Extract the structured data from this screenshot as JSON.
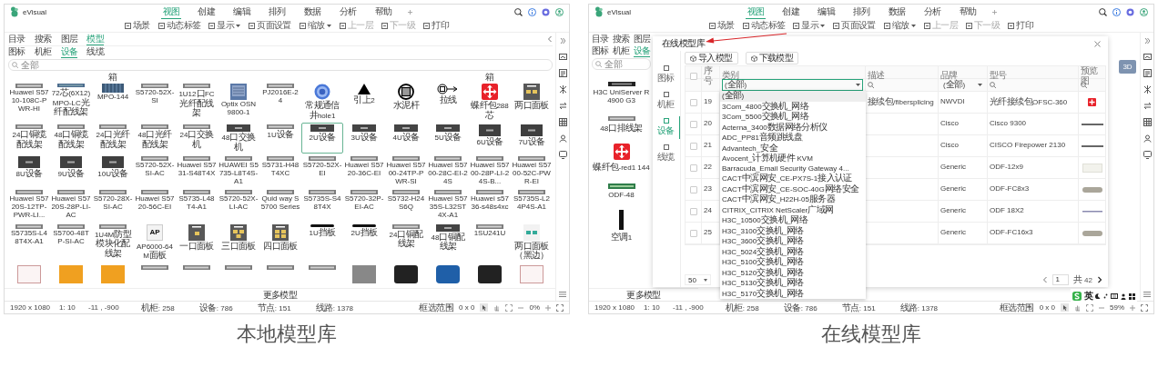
{
  "panels": [
    {
      "app_name": "eVisual",
      "menu_tabs": [
        {
          "label": "视图",
          "selected": true
        },
        {
          "label": "创建",
          "selected": false
        },
        {
          "label": "编辑",
          "selected": false
        },
        {
          "label": "排列",
          "selected": false
        },
        {
          "label": "数据",
          "selected": false
        },
        {
          "label": "分析",
          "selected": false
        },
        {
          "label": "帮助",
          "selected": false
        }
      ],
      "toolbar": [
        {
          "label": "场景",
          "dropdown": false,
          "disabled": false
        },
        {
          "label": "动态标签",
          "dropdown": false,
          "disabled": false
        },
        {
          "label": "显示",
          "dropdown": true,
          "disabled": false
        },
        {
          "label": "页面设置",
          "dropdown": false,
          "disabled": false
        },
        {
          "label": "缩放",
          "dropdown": true,
          "disabled": false
        },
        {
          "label": "上一层",
          "dropdown": false,
          "disabled": true
        },
        {
          "label": "下一级",
          "dropdown": false,
          "disabled": true
        },
        {
          "label": "打印",
          "dropdown": false,
          "disabled": false
        }
      ],
      "side_tabs": [
        {
          "label": "目录",
          "selected": false
        },
        {
          "label": "搜索",
          "selected": false
        },
        {
          "label": "图层",
          "selected": false
        },
        {
          "label": "模型",
          "selected": true
        }
      ],
      "sub_tabs": [
        {
          "label": "图标",
          "selected": false
        },
        {
          "label": "机柜",
          "selected": false
        },
        {
          "label": "设备",
          "selected": true
        },
        {
          "label": "线缆",
          "selected": false
        }
      ],
      "search": {
        "placeholder": "全部"
      },
      "model_grid": {
        "headings": [
          "箱",
          "箱"
        ],
        "items": [
          {
            "label": "Huawei S5710-108C-PWR-HI",
            "kind": "strip",
            "selected": false
          },
          {
            "label": "72芯(6X12)MPO-LC光纤配线架",
            "kind": "blue-strip",
            "selected": false
          },
          {
            "label": "MPO-144",
            "kind": "module",
            "selected": false
          },
          {
            "label": "S5720-52X-SI",
            "kind": "strip",
            "selected": false
          },
          {
            "label": "1U12口FC光纤配线架",
            "kind": "strip",
            "selected": false
          },
          {
            "label": "Optix OSN 9800-1",
            "kind": "chassis",
            "selected": false
          },
          {
            "label": "PJ2016E-24",
            "kind": "strip",
            "selected": false
          },
          {
            "label": "常规通信井hole1",
            "kind": "well",
            "selected": false
          },
          {
            "label": "引上2",
            "kind": "triangle",
            "selected": false
          },
          {
            "label": "水泥杆",
            "kind": "pole",
            "selected": false
          },
          {
            "label": "拉线",
            "kind": "guy",
            "selected": false
          },
          {
            "label": "蝶纤包288芯",
            "kind": "redbox",
            "selected": false
          },
          {
            "label": "两口面板",
            "kind": "panel2",
            "selected": false
          },
          {
            "label": "24口铜缆配线架",
            "kind": "strip",
            "selected": false
          },
          {
            "label": "48口铜缆配线架",
            "kind": "strip",
            "selected": false
          },
          {
            "label": "24口光纤配线架",
            "kind": "strip",
            "selected": false
          },
          {
            "label": "48口光纤配线架",
            "kind": "strip",
            "selected": false
          },
          {
            "label": "24口交换机",
            "kind": "strip",
            "selected": false
          },
          {
            "label": "48口交换机",
            "kind": "device",
            "selected": false
          },
          {
            "label": "1U设备",
            "kind": "strip",
            "selected": false
          },
          {
            "label": "2U设备",
            "kind": "device",
            "selected": true
          },
          {
            "label": "3U设备",
            "kind": "device",
            "selected": false
          },
          {
            "label": "4U设备",
            "kind": "device",
            "selected": false
          },
          {
            "label": "5U设备",
            "kind": "device",
            "selected": false
          },
          {
            "label": "6U设备",
            "kind": "block",
            "selected": false
          },
          {
            "label": "7U设备",
            "kind": "block",
            "selected": false
          },
          {
            "label": "8U设备",
            "kind": "block",
            "selected": false
          },
          {
            "label": "9U设备",
            "kind": "block",
            "selected": false
          },
          {
            "label": "10U设备",
            "kind": "block",
            "selected": false
          },
          {
            "label": "S5720-52X-SI-AC",
            "kind": "strip",
            "selected": false
          },
          {
            "label": "Huawei S5731-S48T4X",
            "kind": "strip",
            "selected": false
          },
          {
            "label": "HUAWEI S5735-L8T4S-A1",
            "kind": "strip",
            "selected": false
          },
          {
            "label": "S5731-H48T4XC",
            "kind": "strip",
            "selected": false
          },
          {
            "label": "S5720-52X-EI",
            "kind": "strip",
            "selected": false
          },
          {
            "label": "Huawei S5720-36C-EI",
            "kind": "strip",
            "selected": false
          },
          {
            "label": "Huawei S5700-24TP-PWR-SI",
            "kind": "strip",
            "selected": false
          },
          {
            "label": "Huawei S5700-28C-EI-24S",
            "kind": "strip",
            "selected": false
          },
          {
            "label": "Huawei S5700-28P-LI-24S-B...",
            "kind": "strip",
            "selected": false
          },
          {
            "label": "Huawei S5700-52C-PWR-EI",
            "kind": "strip",
            "selected": false
          },
          {
            "label": "Huawei S5720S-12TP-PWR-LI...",
            "kind": "strip",
            "selected": false
          },
          {
            "label": "Huawei S5720S-28P-LI-AC",
            "kind": "strip",
            "selected": false
          },
          {
            "label": "S5720-28X-SI-AC",
            "kind": "strip",
            "selected": false
          },
          {
            "label": "Huawei S5720-56C-EI",
            "kind": "strip",
            "selected": false
          },
          {
            "label": "S5735-L48T4-A1",
            "kind": "strip",
            "selected": false
          },
          {
            "label": "S5720-52X-LI-AC",
            "kind": "strip",
            "selected": false
          },
          {
            "label": "Quid way S5700 Series",
            "kind": "strip",
            "selected": false
          },
          {
            "label": "S5735S-S48T4X",
            "kind": "strip",
            "selected": false
          },
          {
            "label": "S5720-32P-EI-AC",
            "kind": "strip",
            "selected": false
          },
          {
            "label": "S5732-H24S6Q",
            "kind": "strip",
            "selected": false
          },
          {
            "label": "Huawei S5735S-L32ST4X-A1",
            "kind": "strip",
            "selected": false
          },
          {
            "label": "Huawei s5736-s48s4xc",
            "kind": "strip",
            "selected": false
          },
          {
            "label": "S5735S-L24P4S-A1",
            "kind": "strip",
            "selected": false
          },
          {
            "label": "S5735S-L48T4X-A1",
            "kind": "strip",
            "selected": false
          },
          {
            "label": "S5700-48TP-SI-AC",
            "kind": "strip",
            "selected": false
          },
          {
            "label": "1U4M防型模块化配线架",
            "kind": "strip",
            "selected": false
          },
          {
            "label": "AP6000-64M面板",
            "kind": "ap",
            "badge": "AP",
            "selected": false
          },
          {
            "label": "一口面板",
            "kind": "panel1",
            "selected": false
          },
          {
            "label": "三口面板",
            "kind": "panel3",
            "selected": false
          },
          {
            "label": "四口面板",
            "kind": "panel4",
            "selected": false
          },
          {
            "label": "1U挡板",
            "kind": "plate",
            "selected": false
          },
          {
            "label": "2U挡板",
            "kind": "plate",
            "selected": false
          },
          {
            "label": "24口铜配线架",
            "kind": "strip",
            "selected": false
          },
          {
            "label": "48口铜配线架",
            "kind": "device",
            "selected": false
          },
          {
            "label": "1SU241U",
            "kind": "strip",
            "selected": false
          },
          {
            "label": "两口面板（黑边）",
            "kind": "whitepanel",
            "selected": false
          },
          {
            "kind": "stub-light",
            "selected": false
          },
          {
            "kind": "stub-orange",
            "selected": false
          },
          {
            "kind": "stub-orange",
            "selected": false
          },
          {
            "kind": "strip",
            "selected": false
          },
          {
            "kind": "strip",
            "selected": false
          },
          {
            "kind": "strip",
            "selected": false
          },
          {
            "kind": "strip",
            "selected": false
          },
          {
            "kind": "strip",
            "selected": false
          },
          {
            "kind": "stub-grey",
            "selected": false
          },
          {
            "kind": "stub-dark",
            "selected": false
          },
          {
            "kind": "stub-blue",
            "selected": false
          },
          {
            "kind": "stub-dark",
            "selected": false
          },
          {
            "kind": "stub-light",
            "selected": false
          }
        ]
      },
      "more_button": "更多模型",
      "status_bar": {
        "resolution": "1920 x 1080",
        "scale": "1: 10",
        "position": "-11 , -900",
        "counts": [
          "机柜: 258",
          "设备: 786",
          "节点: 151",
          "线路: 1378"
        ],
        "selection_label": "框选范围",
        "selection": "0 x 0",
        "zoom": "0%"
      },
      "caption": "本地模型库"
    },
    {
      "app_name": "eVisual",
      "menu_tabs": [
        {
          "label": "视图",
          "selected": true
        },
        {
          "label": "创建",
          "selected": false
        },
        {
          "label": "编辑",
          "selected": false
        },
        {
          "label": "排列",
          "selected": false
        },
        {
          "label": "数据",
          "selected": false
        },
        {
          "label": "分析",
          "selected": false
        },
        {
          "label": "帮助",
          "selected": false
        }
      ],
      "toolbar": [
        {
          "label": "场景",
          "dropdown": false,
          "disabled": false
        },
        {
          "label": "动态标签",
          "dropdown": false,
          "disabled": false
        },
        {
          "label": "显示",
          "dropdown": true,
          "disabled": false
        },
        {
          "label": "页面设置",
          "dropdown": false,
          "disabled": false
        },
        {
          "label": "缩放",
          "dropdown": true,
          "disabled": false
        },
        {
          "label": "上一层",
          "dropdown": false,
          "disabled": true
        },
        {
          "label": "下一级",
          "dropdown": false,
          "disabled": true
        },
        {
          "label": "打印",
          "dropdown": false,
          "disabled": false
        }
      ],
      "side_tabs": [
        {
          "label": "目录",
          "selected": false
        },
        {
          "label": "搜索",
          "selected": false
        },
        {
          "label": "图层",
          "selected": false
        }
      ],
      "sub_tabs": [
        {
          "label": "图标",
          "selected": false
        },
        {
          "label": "机柜",
          "selected": false
        },
        {
          "label": "设备",
          "selected": true
        }
      ],
      "search": {
        "placeholder": "全部"
      },
      "model_list": [
        {
          "label": "H3C UniServer R4900 G3",
          "kind": "server"
        },
        {
          "label": "48口排线架",
          "kind": "strip"
        },
        {
          "label": "蝶纤包-red1 144",
          "kind": "redbox"
        },
        {
          "label": "ODF-48",
          "kind": "odf"
        },
        {
          "label": "空调1",
          "kind": "tower"
        }
      ],
      "canvas_button": "3D",
      "dialog": {
        "title": "在线模型库",
        "vtabs": [
          {
            "label": "图标",
            "selected": false
          },
          {
            "label": "机柜",
            "selected": false
          },
          {
            "label": "设备",
            "selected": true
          },
          {
            "label": "线缆",
            "selected": false
          }
        ],
        "actions": [
          "导入模型",
          "下载模型"
        ],
        "columns": [
          "序号",
          "类别",
          "描述",
          "品牌",
          "型号",
          "预览图"
        ],
        "all_checked": false,
        "category_filter": "(全部)",
        "brand_filter": "(全部)",
        "dropdown": [
          {
            "label": "(全部)",
            "selected": true
          },
          {
            "label": "3Com_4800交换机_网络",
            "selected": false
          },
          {
            "label": "3Com_5500交换机_网络",
            "selected": false
          },
          {
            "label": "Acterna_3400数据网络分析仪",
            "selected": false
          },
          {
            "label": "ADC_PP81音频跳线盘",
            "selected": false
          },
          {
            "label": "Advantech_安全",
            "selected": false
          },
          {
            "label": "Avocent_计算机硬件 KVM",
            "selected": false
          },
          {
            "label": "Barracuda_Email Security Gateway 4...",
            "selected": false
          },
          {
            "label": "CACT中滨网安_CE-PX7S-1接入认证",
            "selected": false
          },
          {
            "label": "CACT中滨网安_CE-SOC-40G网络安全",
            "selected": false
          },
          {
            "label": "CACT中滨网安_H22H-05服务器",
            "selected": false
          },
          {
            "label": "CITRIX_CITRIX NetScaler广域网",
            "selected": false
          },
          {
            "label": "H3C_10500交换机_网络",
            "selected": false
          },
          {
            "label": "H3C_3100交换机_网络",
            "selected": false
          },
          {
            "label": "H3C_3600交换机_网络",
            "selected": false
          },
          {
            "label": "H3C_5024交换机_网络",
            "selected": false
          },
          {
            "label": "H3C_5100交换机_网络",
            "selected": false
          },
          {
            "label": "H3C_5120交换机_网络",
            "selected": false
          },
          {
            "label": "H3C_5130交换机_网络",
            "selected": false
          },
          {
            "label": "H3C_5170交换机_网络",
            "selected": false
          }
        ],
        "rows": [
          {
            "no": "19",
            "description": "接续包/fibersplicing",
            "brand": "NWVDI",
            "model": "光纤接续包OFSC-360",
            "kind": "redbox",
            "checked": false
          },
          {
            "no": "20",
            "brand": "Cisco",
            "model": "Cisco 9300",
            "kind": "line",
            "checked": false
          },
          {
            "no": "21",
            "brand": "Cisco",
            "model": "CISCO Firepower 2130",
            "kind": "line",
            "checked": false
          },
          {
            "no": "22",
            "brand": "Generic",
            "model": "ODF-12x9",
            "kind": "plate",
            "checked": false
          },
          {
            "no": "23",
            "brand": "Generic",
            "model": "ODF-FC8x3",
            "kind": "pill",
            "checked": false
          },
          {
            "no": "24",
            "brand": "Generic",
            "model": "ODF 18X2",
            "kind": "thin",
            "checked": false
          },
          {
            "no": "25",
            "brand": "Generic",
            "model": "ODF-FC16x3",
            "kind": "pill",
            "checked": false
          }
        ],
        "page_size": "50",
        "page": "1",
        "total": "共 42"
      },
      "ime": {
        "label": "英"
      },
      "more_button": "更多模型",
      "status_bar": {
        "resolution": "1920 x 1080",
        "scale": "1: 10",
        "position": "-11 , -900",
        "counts": [
          "机柜: 258",
          "设备: 786",
          "节点: 151",
          "线路: 1378"
        ],
        "selection_label": "框选范围",
        "selection": "0 x 0",
        "zoom": "59%"
      },
      "caption": "在线模型库"
    }
  ]
}
